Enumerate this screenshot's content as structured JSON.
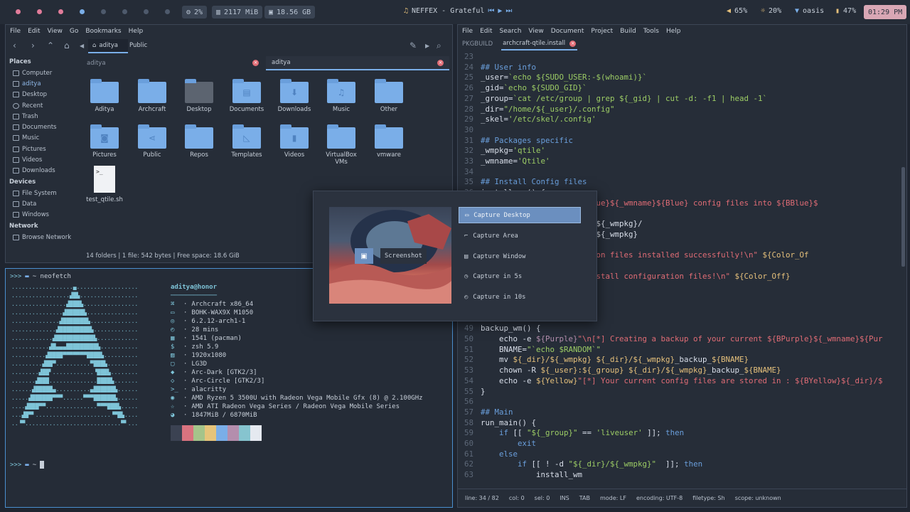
{
  "topbar": {
    "cpu": "2%",
    "ram": "2117 MiB",
    "disk": "18.56 GB",
    "music": "NEFFEX - Grateful",
    "volume": "65%",
    "brightness": "20%",
    "wifi": "oasis",
    "battery": "47%",
    "clock": "01:29 PM",
    "colors": {
      "ws1": "#e17c9a",
      "ws2": "#e17c9a",
      "ws3": "#e17c9a",
      "ws4": "#7aaee8",
      "ws5": "#4e5a6c",
      "ws6": "#4e5a6c",
      "ws7": "#4e5a6c",
      "ws8": "#4e5a6c"
    }
  },
  "filemanager": {
    "menu": [
      "File",
      "Edit",
      "View",
      "Go",
      "Bookmarks",
      "Help"
    ],
    "breadcrumb": [
      "aditya",
      "Public"
    ],
    "places_header": "Places",
    "places": [
      "Computer",
      "aditya",
      "Desktop",
      "Recent",
      "Trash",
      "Documents",
      "Music",
      "Pictures",
      "Videos",
      "Downloads"
    ],
    "devices_header": "Devices",
    "devices": [
      "File System",
      "Data",
      "Windows"
    ],
    "network_header": "Network",
    "network": [
      "Browse Network"
    ],
    "pane_left": "aditya",
    "pane_right": "aditya",
    "folders_row1": [
      "Aditya",
      "Archcraft",
      "Desktop",
      "Documents",
      "Downloads",
      "Music",
      "Other"
    ],
    "folders_row2": [
      "Pictures",
      "Public",
      "Repos",
      "Templates",
      "Videos",
      "VirtualBox VMs",
      "vmware"
    ],
    "file": "test_qtile.sh",
    "status": "14 folders  |  1 file: 542 bytes  |  Free space: 18.6 GiB"
  },
  "terminal": {
    "prompt1": ">>> ",
    "cmd1": "~ neofetch",
    "user": "aditya@honor",
    "info": [
      "Archcraft x86_64",
      "BOHK-WAX9X M1050",
      "6.2.12-arch1-1",
      "28 mins",
      "1541 (pacman)",
      "zsh 5.9",
      "1920x1080",
      "LG3D",
      "Arc-Dark [GTK2/3]",
      "Arc-Circle [GTK2/3]",
      "alacritty",
      "AMD Ryzen 5 3500U with Radeon Vega Mobile Gfx (8) @ 2.100GHz",
      "AMD ATI Radeon Vega Series / Radeon Vega Mobile Series",
      "1847MiB / 6870MiB"
    ],
    "prompt2": ">>> ",
    "cmd2": "~",
    "palette": [
      "#3b4252",
      "#d9737f",
      "#a5c48a",
      "#e6c47a",
      "#7aaee8",
      "#b48ead",
      "#86c4cf",
      "#e5e9f0"
    ]
  },
  "editor": {
    "menu": [
      "File",
      "Edit",
      "Search",
      "View",
      "Document",
      "Project",
      "Build",
      "Tools",
      "Help"
    ],
    "tabs": [
      "PKGBUILD",
      "archcraft-qtile.install"
    ],
    "status": [
      "line: 34 / 82",
      "col: 0",
      "sel: 0",
      "INS",
      "TAB",
      "mode: LF",
      "encoding: UTF-8",
      "filetype: Sh",
      "scope: unknown"
    ]
  },
  "screenshot_dialog": {
    "thumb_label": "Screenshot",
    "options": [
      "Capture Desktop",
      "Capture Area",
      "Capture Window",
      "Capture in 5s",
      "Capture in 10s"
    ]
  }
}
